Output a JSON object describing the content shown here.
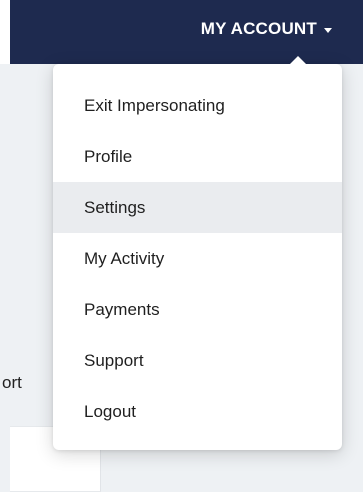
{
  "header": {
    "account_label": "MY ACCOUNT",
    "caret_icon": "caret-down-icon"
  },
  "background_card": {
    "partial_text": "ort"
  },
  "dropdown": {
    "items": [
      {
        "label": "Exit Impersonating",
        "active": false
      },
      {
        "label": "Profile",
        "active": false
      },
      {
        "label": "Settings",
        "active": true
      },
      {
        "label": "My Activity",
        "active": false
      },
      {
        "label": "Payments",
        "active": false
      },
      {
        "label": "Support",
        "active": false
      },
      {
        "label": "Logout",
        "active": false
      }
    ]
  },
  "colors": {
    "header_bg": "#1e2a4f",
    "page_bg": "#eef1f4",
    "active_item_bg": "#eaecef"
  }
}
